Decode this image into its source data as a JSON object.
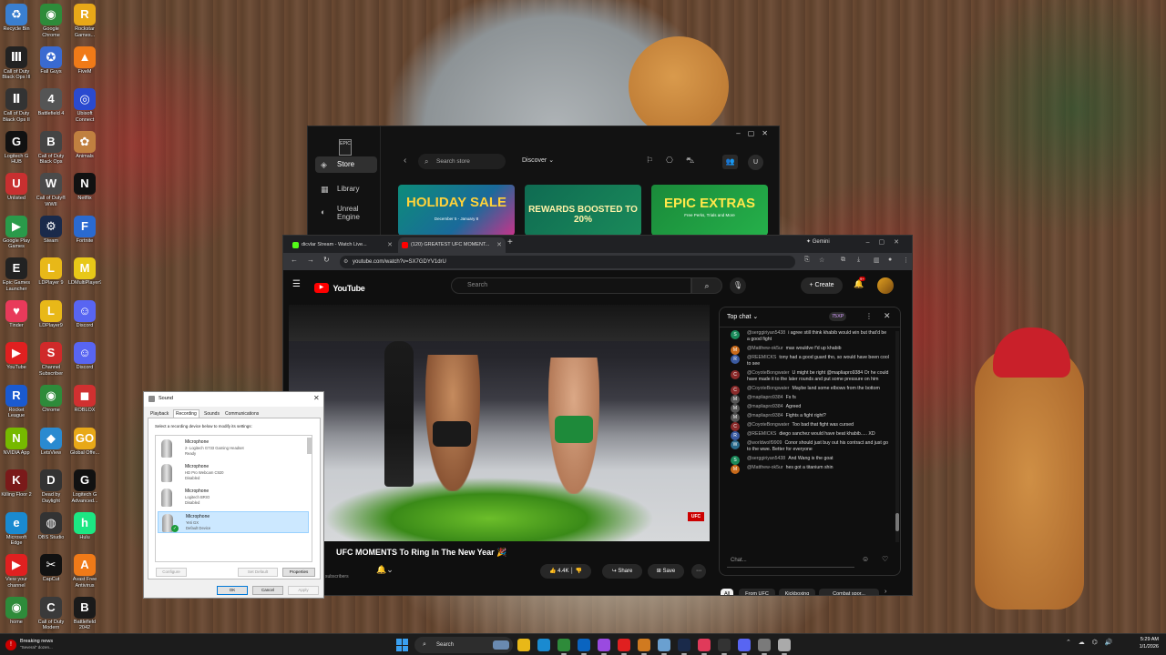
{
  "desktop": {
    "icons": [
      {
        "label": "Recycle Bin",
        "color": "#3a7fd0",
        "glyph": "♻"
      },
      {
        "label": "Google Chrome",
        "color": "#2e8b3a",
        "glyph": "◉"
      },
      {
        "label": "Rockstar Games...",
        "color": "#e8a818",
        "glyph": "R"
      },
      {
        "label": "Call of Duty Black Ops III",
        "color": "#222222",
        "glyph": "Ⅲ"
      },
      {
        "label": "Fall Guys",
        "color": "#3a6ad0",
        "glyph": "✪"
      },
      {
        "label": "FiveM",
        "color": "#f07a18",
        "glyph": "▲"
      },
      {
        "label": "Call of Duty Black Ops II",
        "color": "#333333",
        "glyph": "Ⅱ"
      },
      {
        "label": "Battlefield 4",
        "color": "#555555",
        "glyph": "4"
      },
      {
        "label": "Ubisoft Connect",
        "color": "#2a4ad0",
        "glyph": "◎"
      },
      {
        "label": "Logitech G HUB",
        "color": "#111111",
        "glyph": "G"
      },
      {
        "label": "Call of Duty Black Ops",
        "color": "#444444",
        "glyph": "B"
      },
      {
        "label": "Animals",
        "color": "#c08040",
        "glyph": "✿"
      },
      {
        "label": "Unlisted",
        "color": "#c83030",
        "glyph": "U"
      },
      {
        "label": "Call of Duty® WWII",
        "color": "#4a4a4a",
        "glyph": "W"
      },
      {
        "label": "Netflix",
        "color": "#111111",
        "glyph": "N"
      },
      {
        "label": "Google Play Games",
        "color": "#2a9a4a",
        "glyph": "▶"
      },
      {
        "label": "Steam",
        "color": "#1a2a4a",
        "glyph": "⚙"
      },
      {
        "label": "Fortnite",
        "color": "#2a6ad0",
        "glyph": "F"
      },
      {
        "label": "Epic Games Launcher",
        "color": "#222222",
        "glyph": "E"
      },
      {
        "label": "LDPlayer 9",
        "color": "#e8b818",
        "glyph": "L"
      },
      {
        "label": "LDMultiPlayer9",
        "color": "#e8c818",
        "glyph": "M"
      },
      {
        "label": "Tinder",
        "color": "#e83a5a",
        "glyph": "♥"
      },
      {
        "label": "LDPlayer9",
        "color": "#e8b818",
        "glyph": "L"
      },
      {
        "label": "Discord",
        "color": "#5865f2",
        "glyph": "☺"
      },
      {
        "label": "YouTube",
        "color": "#e02020",
        "glyph": "▶"
      },
      {
        "label": "Channel Subscriber",
        "color": "#d02a2a",
        "glyph": "S"
      },
      {
        "label": "Discord",
        "color": "#5865f2",
        "glyph": "☺"
      },
      {
        "label": "Rocket League",
        "color": "#1a5ad0",
        "glyph": "R"
      },
      {
        "label": "Chrome",
        "color": "#2e8b3a",
        "glyph": "◉"
      },
      {
        "label": "ROBLOX",
        "color": "#d03030",
        "glyph": "◼"
      },
      {
        "label": "NVIDIA App",
        "color": "#76b900",
        "glyph": "N"
      },
      {
        "label": "LetsView",
        "color": "#2a8ad0",
        "glyph": "◆"
      },
      {
        "label": "Global Offe...",
        "color": "#e8a818",
        "glyph": "GO"
      },
      {
        "label": "Killing Floor 2",
        "color": "#7a1a1a",
        "glyph": "K"
      },
      {
        "label": "Dead by Daylight",
        "color": "#333333",
        "glyph": "D"
      },
      {
        "label": "Logitech G Advanced...",
        "color": "#111111",
        "glyph": "G"
      },
      {
        "label": "Microsoft Edge",
        "color": "#1a8ad0",
        "glyph": "e"
      },
      {
        "label": "OBS Studio",
        "color": "#333333",
        "glyph": "◍"
      },
      {
        "label": "Hulu",
        "color": "#1ce783",
        "glyph": "h"
      },
      {
        "label": "View your channel",
        "color": "#e02020",
        "glyph": "▶"
      },
      {
        "label": "CapCut",
        "color": "#111111",
        "glyph": "✂"
      },
      {
        "label": "Avast Free Antivirus",
        "color": "#f07a18",
        "glyph": "A"
      },
      {
        "label": "home",
        "color": "#2e8b3a",
        "glyph": "◉"
      },
      {
        "label": "Call of Duty Modern Warfare",
        "color": "#3a3a3a",
        "glyph": "C"
      },
      {
        "label": "Battlefield 2042",
        "color": "#1a1a1a",
        "glyph": "B"
      },
      {
        "label": "Psycho - Chrome",
        "color": "#2e8b3a",
        "glyph": "◉"
      }
    ]
  },
  "epic": {
    "logo_text": "EPIC",
    "nav": {
      "store": "Store",
      "library": "Library",
      "unreal": "Unreal Engine"
    },
    "search_placeholder": "Search store",
    "discover": "Discover",
    "user_initial": "U",
    "banners": [
      {
        "title": "HOLIDAY SALE",
        "sub": "December 5 - January 8"
      },
      {
        "title": "REWARDS BOOSTED TO 20%",
        "sub": ""
      },
      {
        "title": "EPIC EXTRAS",
        "sub": "Free Perks, Trials and More"
      }
    ]
  },
  "chrome": {
    "tabs": [
      {
        "title": "dicvlar Stream - Watch Live...",
        "favicon_color": "#53fc18"
      },
      {
        "title": "(120) GREATEST UFC MOMENT...",
        "favicon_color": "#ff0000"
      }
    ],
    "gemini": "Gemini",
    "url": "youtube.com/watch?v=SX7GDYV1drU"
  },
  "youtube": {
    "logo_text": "YouTube",
    "search_placeholder": "Search",
    "create_label": "Create",
    "notif_count": "9+",
    "video": {
      "title": "UFC MOMENTS To Ring In The New Year 🎉",
      "subs_text": "subscribers",
      "likes": "4.4K",
      "share": "Share",
      "save": "Save",
      "overlay_banner": "UFC"
    },
    "chat": {
      "title": "Top chat",
      "points": "75XP",
      "input_placeholder": "Chat...",
      "messages": [
        {
          "user": "@serggiriyan5438",
          "text": "i agree still think khabib would win but that'd be a good fight",
          "avatar": "S",
          "color": "#1a8a5a"
        },
        {
          "user": "@Matthew-ok5ur",
          "text": "max wouldve f'd up khabib",
          "avatar": "M",
          "color": "#c86a1a"
        },
        {
          "user": "@REEMICKS",
          "text": "tony had a good guard tho, so would have been cool to see",
          "avatar": "R",
          "color": "#3a5aa0"
        },
        {
          "user": "@CoyoteBongwater",
          "text": "U might be right @mapliapro9384 Or he could have made it to the later rounds and put some pressure on him",
          "avatar": "C",
          "color": "#8a2a2a"
        },
        {
          "user": "@CoyoteBongwater",
          "text": "Maybe land some elbows from the bottom",
          "avatar": "C",
          "color": "#8a2a2a"
        },
        {
          "user": "@mapliapro9384",
          "text": "Fs fs",
          "avatar": "M",
          "color": "#555555"
        },
        {
          "user": "@mapliapro9384",
          "text": "Agreed",
          "avatar": "M",
          "color": "#555555"
        },
        {
          "user": "@mapliapro9384",
          "text": "Fights a fight right?",
          "avatar": "M",
          "color": "#555555"
        },
        {
          "user": "@CoyoteBongwater",
          "text": "Too bad that fight was cursed",
          "avatar": "C",
          "color": "#8a2a2a"
        },
        {
          "user": "@REEMICKS",
          "text": "diego sanchez would have beat khabib..... XD",
          "avatar": "R",
          "color": "#3a5aa0"
        },
        {
          "user": "@worldwolf9909",
          "text": "Conor should just buy out his contract and just go to the wwe. Better for everyone",
          "avatar": "W",
          "color": "#2a6a8a"
        },
        {
          "user": "@serggiriyan5438",
          "text": "And Wang is the goat",
          "avatar": "S",
          "color": "#1a8a5a"
        },
        {
          "user": "@Matthew-ok5ur",
          "text": "hes got a titanium shin",
          "avatar": "M",
          "color": "#c86a1a"
        }
      ]
    },
    "chips": [
      "All",
      "From UFC",
      "Kickboxing",
      "Combat spor..."
    ]
  },
  "sound": {
    "title": "Sound",
    "tabs": [
      "Playback",
      "Recording",
      "Sounds",
      "Communications"
    ],
    "instruction": "Select a recording device below to modify its settings:",
    "devices": [
      {
        "name": "Microphone",
        "desc": "2- Logitech G733 Gaming Headset",
        "status": "Ready"
      },
      {
        "name": "Microphone",
        "desc": "HD Pro Webcam C920",
        "status": "Disabled"
      },
      {
        "name": "Microphone",
        "desc": "Logitech BRIO",
        "status": "Disabled"
      },
      {
        "name": "Microphone",
        "desc": "Yeti GX",
        "status": "Default Device"
      }
    ],
    "buttons": {
      "configure": "Configure",
      "set_default": "Set Default",
      "properties": "Properties",
      "ok": "OK",
      "cancel": "Cancel",
      "apply": "Apply"
    }
  },
  "taskbar": {
    "news_title": "Breaking news",
    "news_sub": "\"Several\" dozen...",
    "search": "Search",
    "time": "5:29 AM",
    "date": "1/1/2026",
    "apps": [
      {
        "name": "File Explorer",
        "color": "#e8b818"
      },
      {
        "name": "Microsoft Edge",
        "color": "#1a8ad0"
      },
      {
        "name": "Chrome",
        "color": "#2e8b3a"
      },
      {
        "name": "Outlook",
        "color": "#0a64c0"
      },
      {
        "name": "Copilot",
        "color": "#9a4ae0"
      },
      {
        "name": "YouTube",
        "color": "#e02020"
      },
      {
        "name": "Chrome Profile",
        "color": "#d07a20"
      },
      {
        "name": "Notepad",
        "color": "#6aa0d0"
      },
      {
        "name": "Steam",
        "color": "#1a2a4a"
      },
      {
        "name": "Music",
        "color": "#e03a5a"
      },
      {
        "name": "Epic Games",
        "color": "#333333"
      },
      {
        "name": "Discord",
        "color": "#5865f2"
      },
      {
        "name": "Settings",
        "color": "#7a7a7a"
      },
      {
        "name": "Sound",
        "color": "#aaaaaa"
      }
    ]
  }
}
